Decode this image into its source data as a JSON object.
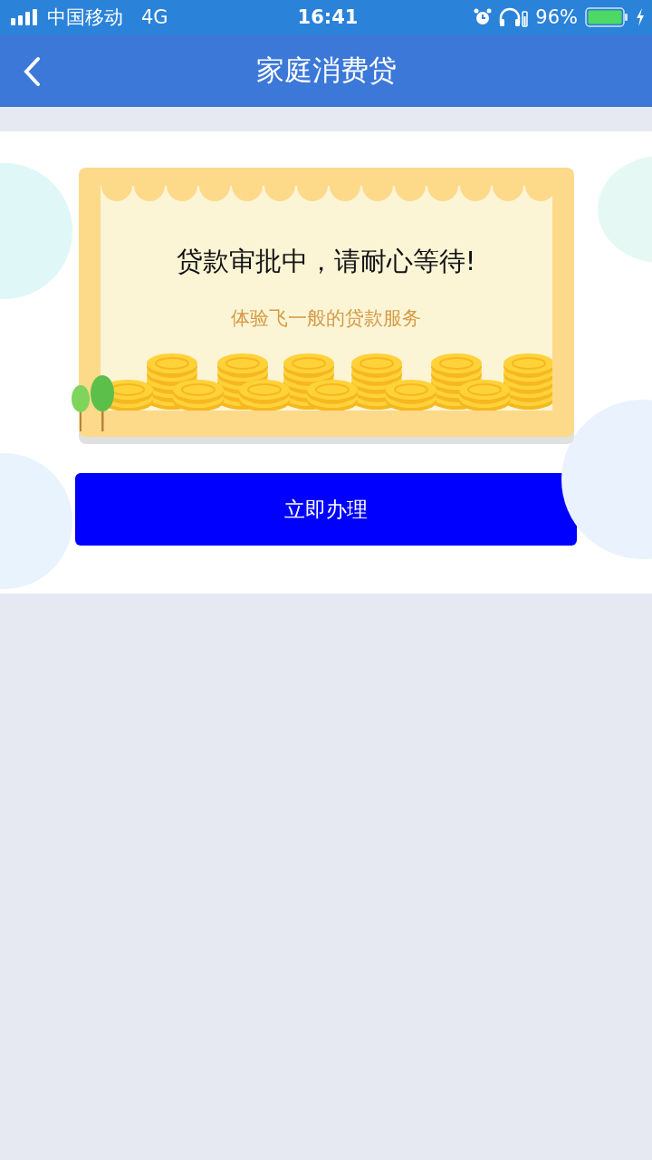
{
  "status_bar": {
    "carrier": "中国移动",
    "network": "4G",
    "time": "16:41",
    "battery_percent": "96%"
  },
  "nav_bar": {
    "title": "家庭消费贷"
  },
  "banner": {
    "title": "贷款审批中，请耐心等待!",
    "subtitle": "体验飞一般的贷款服务"
  },
  "action_button": {
    "label": "立即办理"
  }
}
